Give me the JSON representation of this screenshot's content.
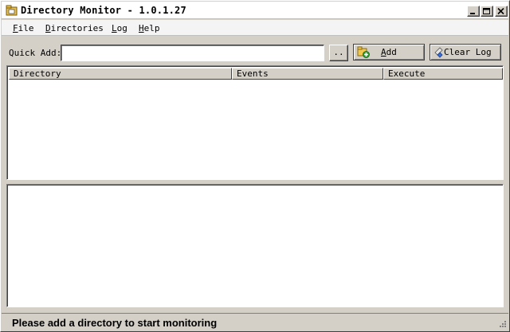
{
  "window": {
    "title": "Directory Monitor - 1.0.1.27",
    "icon": "folder-app-icon",
    "controls": [
      "minimize",
      "maximize",
      "close"
    ]
  },
  "menu": {
    "file": {
      "mnemonic": "F",
      "rest": "ile"
    },
    "directories": {
      "mnemonic": "D",
      "rest": "irectories"
    },
    "log": {
      "mnemonic": "L",
      "rest": "og"
    },
    "help": {
      "mnemonic": "H",
      "rest": "elp"
    }
  },
  "quick_add": {
    "label": "Quick Add:",
    "value": "",
    "browse_label": "..",
    "add_label": "Add",
    "add_mnemonic": "A",
    "add_rest": "dd",
    "add_icon": "add-folder-icon",
    "clear_label": "Clear Log",
    "clear_icon": "eraser-icon"
  },
  "directory_list": {
    "columns": [
      "Directory",
      "Events",
      "Execute"
    ],
    "rows": []
  },
  "log": {
    "entries": []
  },
  "status": {
    "message": "Please add a directory to start monitoring"
  }
}
